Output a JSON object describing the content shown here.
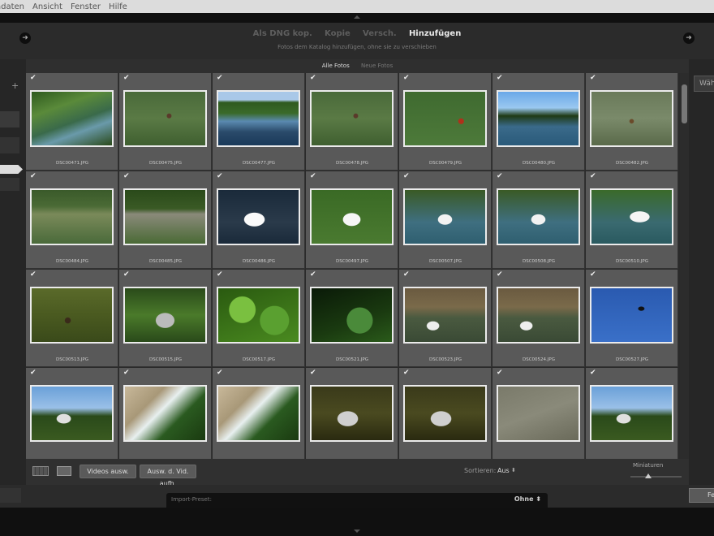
{
  "menu": [
    "adaten",
    "Ansicht",
    "Fenster",
    "Hilfe"
  ],
  "header": {
    "modes": [
      {
        "label": "Als DNG kop.",
        "active": false
      },
      {
        "label": "Kopie",
        "active": false
      },
      {
        "label": "Versch.",
        "active": false
      },
      {
        "label": "Hinzufügen",
        "active": true
      }
    ],
    "description": "Fotos dem Katalog hinzufügen, ohne sie zu verschieben",
    "nav_back_icon": "arrow-left-icon",
    "nav_forward_icon": "arrow-right-icon"
  },
  "left_panel": {
    "add_label": "+"
  },
  "right_panel": {
    "button_label": "Wäh"
  },
  "tabs": [
    {
      "label": "Alle Fotos",
      "active": true
    },
    {
      "label": "Neue Fotos",
      "active": false
    }
  ],
  "photos": [
    {
      "file": "DSC00471.JPG",
      "checked": true,
      "scene": "green-stream"
    },
    {
      "file": "DSC00475.JPG",
      "checked": true,
      "scene": "duck-green-water"
    },
    {
      "file": "DSC00477.JPG",
      "checked": true,
      "scene": "lake-trees-reflection"
    },
    {
      "file": "DSC00478.JPG",
      "checked": true,
      "scene": "duck-green-water"
    },
    {
      "file": "DSC00479.JPG",
      "checked": true,
      "scene": "duck-red-head"
    },
    {
      "file": "DSC00480.JPG",
      "checked": true,
      "scene": "lake-sky-trees"
    },
    {
      "file": "DSC00482.JPG",
      "checked": true,
      "scene": "duck-distant"
    },
    {
      "file": "DSC00484.JPG",
      "checked": true,
      "scene": "reeds-log"
    },
    {
      "file": "DSC00485.JPG",
      "checked": true,
      "scene": "reeds-driftwood"
    },
    {
      "file": "DSC00486.JPG",
      "checked": true,
      "scene": "swan-dark-water"
    },
    {
      "file": "DSC00497.JPG",
      "checked": true,
      "scene": "swan-green-water"
    },
    {
      "file": "DSC00507.JPG",
      "checked": true,
      "scene": "swan-pond"
    },
    {
      "file": "DSC00508.JPG",
      "checked": true,
      "scene": "swan-pond"
    },
    {
      "file": "DSC00510.JPG",
      "checked": true,
      "scene": "swan-wings"
    },
    {
      "file": "DSC00513.JPG",
      "checked": true,
      "scene": "grebe-water"
    },
    {
      "file": "DSC00515.JPG",
      "checked": true,
      "scene": "bridge-forest"
    },
    {
      "file": "DSC00517.JPG",
      "checked": true,
      "scene": "green-leaves"
    },
    {
      "file": "DSC00521.JPG",
      "checked": true,
      "scene": "leaves-dark"
    },
    {
      "file": "DSC00523.JPG",
      "checked": true,
      "scene": "swans-reeds"
    },
    {
      "file": "DSC00524.JPG",
      "checked": true,
      "scene": "swans-reeds"
    },
    {
      "file": "DSC00527.JPG",
      "checked": true,
      "scene": "bird-blue-sky"
    },
    {
      "file": "",
      "checked": true,
      "scene": "castle-trees"
    },
    {
      "file": "",
      "checked": true,
      "scene": "weir-waterfall"
    },
    {
      "file": "",
      "checked": true,
      "scene": "weir-waterfall"
    },
    {
      "file": "",
      "checked": true,
      "scene": "stone-water"
    },
    {
      "file": "",
      "checked": true,
      "scene": "stone-water"
    },
    {
      "file": "",
      "checked": true,
      "scene": "grey-water"
    },
    {
      "file": "",
      "checked": true,
      "scene": "castle-trees"
    }
  ],
  "toolbar": {
    "grid_view_icon": "grid-view-icon",
    "loupe_view_icon": "loupe-view-icon",
    "videos_button": "Videos ausw.",
    "deselect_button": "Ausw. d. Vid. aufh.",
    "sort_label": "Sortieren:",
    "sort_value": "Aus",
    "thumbnails_label": "Miniaturen",
    "thumbnail_size": 0.35
  },
  "footer": {
    "preset_label": "Import-Preset:",
    "preset_value": "Ohne",
    "right_button": "Fe"
  }
}
